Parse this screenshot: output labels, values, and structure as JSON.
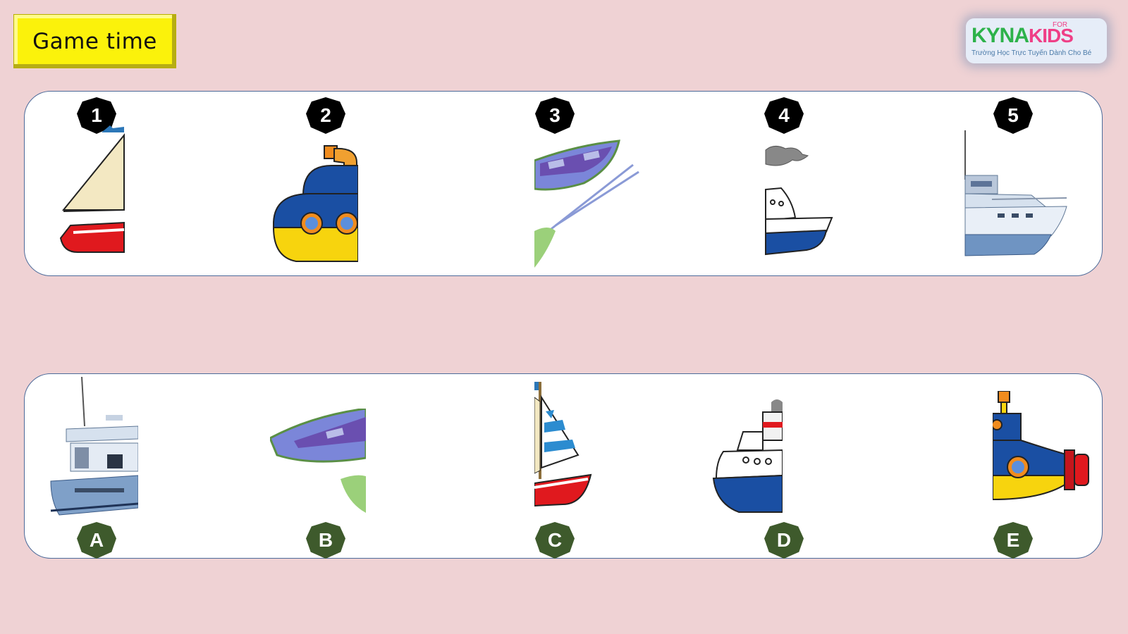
{
  "header": {
    "title": "Game time"
  },
  "logo": {
    "main": "KYNA",
    "accent": "KIDS",
    "superscript": "FOR",
    "tagline": "Trường Học Trực Tuyến Dành Cho Bé"
  },
  "top_row": {
    "items": [
      {
        "label": "1",
        "icon": "sailboat-half-icon"
      },
      {
        "label": "2",
        "icon": "submarine-half-icon"
      },
      {
        "label": "3",
        "icon": "rowboat-half-icon"
      },
      {
        "label": "4",
        "icon": "steamship-half-icon"
      },
      {
        "label": "5",
        "icon": "yacht-half-icon"
      }
    ]
  },
  "bottom_row": {
    "items": [
      {
        "label": "A",
        "icon": "yacht-half-icon"
      },
      {
        "label": "B",
        "icon": "rowboat-half-icon"
      },
      {
        "label": "C",
        "icon": "sailboat-half-icon"
      },
      {
        "label": "D",
        "icon": "steamship-half-icon"
      },
      {
        "label": "E",
        "icon": "submarine-half-icon"
      }
    ]
  },
  "colors": {
    "background": "#efd2d4",
    "title_box": "#fbf20b",
    "number_badge": "#000000",
    "letter_badge": "#3e5a2c",
    "panel_border": "#4d6b9a"
  }
}
